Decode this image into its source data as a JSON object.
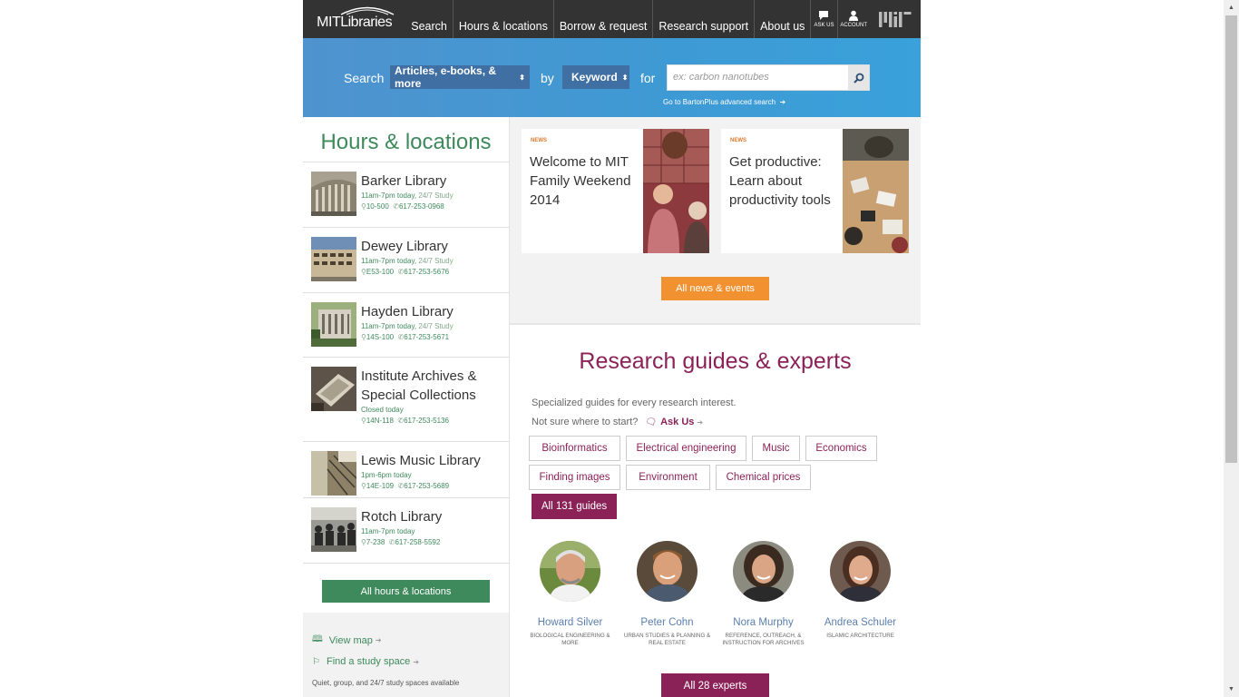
{
  "nav": {
    "logo": "MITLibraries",
    "items": [
      "Search",
      "Hours & locations",
      "Borrow & request",
      "Research support",
      "About us"
    ],
    "ask_us": "ASK US",
    "account": "ACCOUNT",
    "mit_logo": "MIT"
  },
  "search": {
    "label": "Search",
    "scope": "Articles, e-books, & more",
    "by": "by",
    "field": "Keyword",
    "for": "for",
    "placeholder": "ex: carbon nanotubes",
    "advanced": "Go to BartonPlus advanced search"
  },
  "hours": {
    "title": "Hours & locations",
    "libraries": [
      {
        "name": "Barker Library",
        "hours": "11am-7pm today,",
        "study": "24/7 Study",
        "room": "10-500",
        "phone": "617-253-0968"
      },
      {
        "name": "Dewey Library",
        "hours": "11am-7pm today,",
        "study": "24/7 Study",
        "room": "E53-100",
        "phone": "617-253-5676"
      },
      {
        "name": "Hayden Library",
        "hours": "11am-7pm today,",
        "study": "24/7 Study",
        "room": "14S-100",
        "phone": "617-253-5671"
      },
      {
        "name": "Institute Archives & Special Collections",
        "hours": "Closed today",
        "study": "",
        "room": "14N-118",
        "phone": "617-253-5136"
      },
      {
        "name": "Lewis Music Library",
        "hours": "1pm-6pm today",
        "study": "",
        "room": "14E-109",
        "phone": "617-253-5689"
      },
      {
        "name": "Rotch Library",
        "hours": "11am-7pm today",
        "study": "",
        "room": "7-238",
        "phone": "617-258-5592"
      }
    ],
    "all_button": "All hours & locations",
    "view_map": "View map",
    "study_space": "Find a study space",
    "study_note": "Quiet, group, and 24/7 study spaces available"
  },
  "news": {
    "cards": [
      {
        "tag": "NEWS",
        "headline": "Welcome to MIT Family Weekend 2014"
      },
      {
        "tag": "NEWS",
        "headline": "Get productive: Learn about productivity tools"
      }
    ],
    "all_button": "All news & events"
  },
  "research": {
    "title": "Research guides & experts",
    "desc": "Specialized guides for every research interest.",
    "not_sure": "Not sure where to start?",
    "ask_us": "Ask Us",
    "tags": [
      "Bioinformatics",
      "Electrical engineering",
      "Music",
      "Economics",
      "Finding images",
      "Environment",
      "Chemical prices"
    ],
    "all_guides": "All 131 guides",
    "experts": [
      {
        "name": "Howard Silver",
        "subject": "BIOLOGICAL ENGINEERING & MORE"
      },
      {
        "name": "Peter Cohn",
        "subject": "URBAN STUDIES & PLANNING & REAL ESTATE"
      },
      {
        "name": "Nora Murphy",
        "subject": "REFERENCE, OUTREACH, & INSTRUCTION FOR ARCHIVES"
      },
      {
        "name": "Andrea Schuler",
        "subject": "ISLAMIC ARCHITECTURE"
      }
    ],
    "all_experts": "All 28 experts"
  },
  "colors": {
    "nav_bg": "#333333",
    "search_blue": "#3e9ad4",
    "green": "#3e8a5c",
    "orange": "#f19130",
    "plum": "#8b2257"
  }
}
